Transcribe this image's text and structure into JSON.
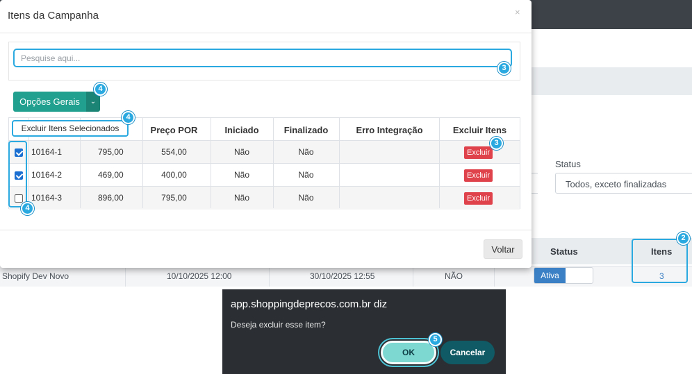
{
  "modal": {
    "title": "Itens da Campanha",
    "close": "×",
    "search_placeholder": "Pesquise aqui...",
    "options_button": "Opções Gerais",
    "dropdown_item": "Excluir Itens Selecionados",
    "back_button": "Voltar"
  },
  "table": {
    "headers": [
      "Preço POR",
      "Iniciado",
      "Finalizado",
      "Erro Integração",
      "Excluir Itens"
    ],
    "rows": [
      {
        "checked": true,
        "sku": "10164-1",
        "preco_de": "795,00",
        "preco_por": "554,00",
        "iniciado": "Não",
        "finalizado": "Não",
        "erro": "",
        "action": "Excluir"
      },
      {
        "checked": true,
        "sku": "10164-2",
        "preco_de": "469,00",
        "preco_por": "400,00",
        "iniciado": "Não",
        "finalizado": "Não",
        "erro": "",
        "action": "Excluir"
      },
      {
        "checked": false,
        "sku": "10164-3",
        "preco_de": "896,00",
        "preco_por": "795,00",
        "iniciado": "Não",
        "finalizado": "Não",
        "erro": "",
        "action": "Excluir"
      }
    ]
  },
  "background": {
    "status_label": "Status",
    "status_value": "Todos, exceto finalizadas",
    "col_status": "Status",
    "col_itens": "Itens",
    "row": {
      "name": "Shopify Dev Novo",
      "start": "10/10/2025 12:00",
      "end": "30/10/2025 12:55",
      "flag": "NÃO",
      "status": "Ativa",
      "itens": "3"
    }
  },
  "dialog": {
    "title": "app.shoppingdeprecos.com.br diz",
    "message": "Deseja excluir esse item?",
    "ok": "OK",
    "cancel": "Cancelar"
  },
  "badges": {
    "search": "3",
    "options": "4",
    "dropdown": "4",
    "checkboxes": "4",
    "excluir": "3",
    "itens": "2",
    "ok": "5"
  },
  "colors": {
    "highlight": "#29a9e0",
    "primary_teal": "#22a08f",
    "danger": "#e0424b",
    "dialog_bg": "#2b2f33"
  }
}
